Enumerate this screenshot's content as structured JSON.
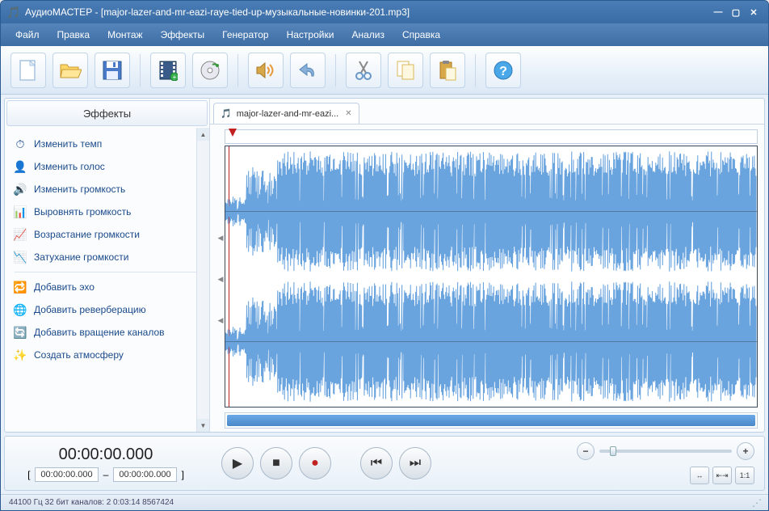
{
  "window": {
    "title": "АудиоМАСТЕР - [major-lazer-and-mr-eazi-raye-tied-up-музыкальные-новинки-201.mp3]"
  },
  "menu": {
    "items": [
      "Файл",
      "Правка",
      "Монтаж",
      "Эффекты",
      "Генератор",
      "Настройки",
      "Анализ",
      "Справка"
    ]
  },
  "toolbar": {
    "icons": [
      "new",
      "open",
      "save",
      "video",
      "cd",
      "speaker",
      "undo",
      "cut",
      "copy",
      "paste",
      "help"
    ]
  },
  "sidebar": {
    "header": "Эффекты",
    "groups": [
      [
        {
          "icon": "⏱",
          "label": "Изменить темп"
        },
        {
          "icon": "👤",
          "label": "Изменить голос"
        },
        {
          "icon": "🔊",
          "label": "Изменить громкость"
        },
        {
          "icon": "📊",
          "label": "Выровнять громкость"
        },
        {
          "icon": "📈",
          "label": "Возрастание громкости"
        },
        {
          "icon": "📉",
          "label": "Затухание громкости"
        }
      ],
      [
        {
          "icon": "🔁",
          "label": "Добавить эхо"
        },
        {
          "icon": "🌐",
          "label": "Добавить реверберацию"
        },
        {
          "icon": "🔄",
          "label": "Добавить вращение каналов"
        },
        {
          "icon": "✨",
          "label": "Создать атмосферу"
        }
      ]
    ]
  },
  "tab": {
    "label": "major-lazer-and-mr-eazi..."
  },
  "time": {
    "main": "00:00:00.000",
    "from": "00:00:00.000",
    "to": "00:00:00.000",
    "sep": "–"
  },
  "status": {
    "text": "44100 Гц  32 бит  каналов: 2   0:03:14 8567424"
  },
  "fit": {
    "ratio": "1:1"
  }
}
